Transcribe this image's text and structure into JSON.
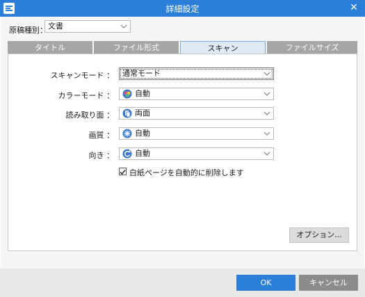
{
  "window": {
    "title": "詳細設定"
  },
  "document_type": {
    "label": "原稿種別：",
    "value": "文書"
  },
  "tabs": [
    {
      "label": "タイトル"
    },
    {
      "label": "ファイル形式"
    },
    {
      "label": "スキャン",
      "active": true
    },
    {
      "label": "ファイルサイズ"
    }
  ],
  "scan": {
    "scan_mode": {
      "label": "スキャンモード ：",
      "value": "通常モード"
    },
    "color_mode": {
      "label": "カラーモード ：",
      "value": "自動",
      "icon": "color-mode-icon"
    },
    "read_side": {
      "label": "読み取り面 ：",
      "value": "両面",
      "icon": "duplex-icon"
    },
    "quality": {
      "label": "画質 ：",
      "value": "自動",
      "icon": "quality-icon"
    },
    "orientation": {
      "label": "向き ：",
      "value": "自動",
      "icon": "rotation-icon"
    },
    "blank_page": {
      "label": "白紙ページを自動的に削除します",
      "checked": true
    }
  },
  "buttons": {
    "options": "オプション...",
    "ok": "OK",
    "cancel": "キャンセル"
  },
  "colors": {
    "accent": "#2b7fd8",
    "tab_inactive": "#a6a6a6",
    "cancel": "#8c8c8c"
  }
}
